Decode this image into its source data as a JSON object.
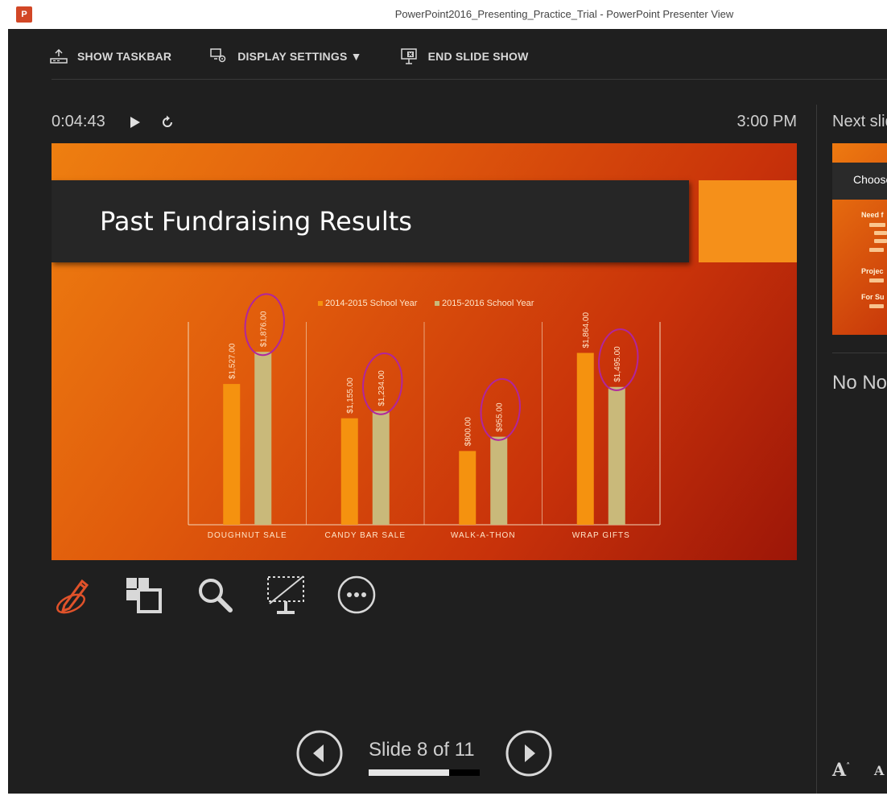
{
  "window": {
    "title": "PowerPoint2016_Presenting_Practice_Trial - PowerPoint Presenter View",
    "app_icon_label": "P"
  },
  "toolbar": {
    "show_taskbar": "SHOW TASKBAR",
    "display_settings": "DISPLAY SETTINGS ▼",
    "end_slide_show": "END SLIDE SHOW"
  },
  "presenter": {
    "timer": "0:04:43",
    "clock": "3:00 PM",
    "next_slide_label": "Next slide",
    "notes_text": "No Notes",
    "slide_counter": "Slide 8 of 11",
    "progress_fraction": 0.727,
    "font_increase": "A",
    "font_decrease": "A"
  },
  "slide": {
    "title": "Past Fundraising Results"
  },
  "next_slide": {
    "title": "Choose",
    "bullets": [
      "Need f",
      "Projec",
      "For Su"
    ]
  },
  "colors": {
    "series_2014": "#f5920f",
    "series_2015": "#c9b97a",
    "annotation_ink": "#b0259e",
    "pen_active": "#e0522a"
  },
  "tools": [
    "pen-icon",
    "see-all-slides-icon",
    "zoom-icon",
    "black-screen-icon",
    "more-options-icon"
  ],
  "chart_data": {
    "type": "bar",
    "title": "",
    "categories": [
      "DOUGHNUT SALE",
      "CANDY BAR SALE",
      "WALK-A-THON",
      "WRAP GIFTS"
    ],
    "series": [
      {
        "name": "2014-2015 School Year",
        "values": [
          1527,
          1155,
          800,
          1864
        ],
        "labels": [
          "$1,527.00",
          "$1,155.00",
          "$800.00",
          "$1,864.00"
        ]
      },
      {
        "name": "2015-2016 School Year",
        "values": [
          1876,
          1234,
          955,
          1495
        ],
        "labels": [
          "$1,876.00",
          "$1,234.00",
          "$955.00",
          "$1,495.00"
        ]
      }
    ],
    "ylim": [
      0,
      2200
    ],
    "legend": "top",
    "grid": false,
    "annotated_series": "2015-2016 School Year"
  }
}
